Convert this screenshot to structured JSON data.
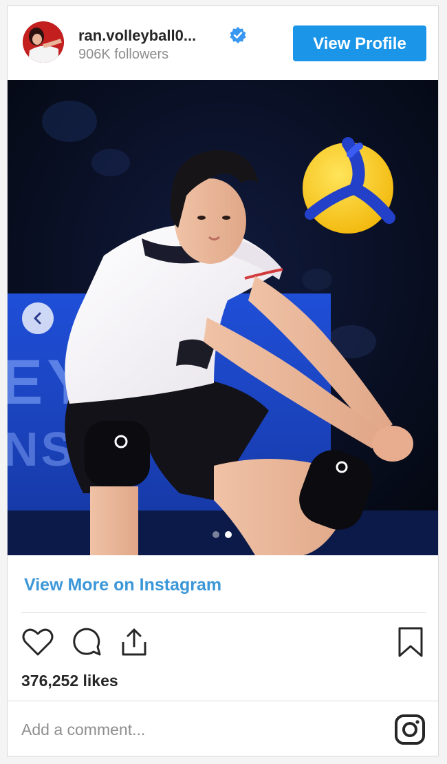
{
  "post": {
    "username": "ran.volleyball0...",
    "followers": "906K followers",
    "view_profile_label": "View Profile",
    "view_more_label": "View More on Instagram",
    "likes": "376,252 likes",
    "comment_placeholder": "Add a comment...",
    "carousel": {
      "slide_count": 2,
      "active_slide": 2
    }
  },
  "colors": {
    "accent": "#1a95e8",
    "link": "#3c97d8",
    "text_primary": "#262626",
    "text_secondary": "#8e8e8e",
    "verified": "#3897f0"
  },
  "icons": {
    "verified": "verified-badge-icon",
    "prev": "chevron-left-icon",
    "like": "heart-icon",
    "comment": "comment-icon",
    "share": "share-icon",
    "save": "bookmark-icon",
    "brand": "instagram-icon"
  }
}
